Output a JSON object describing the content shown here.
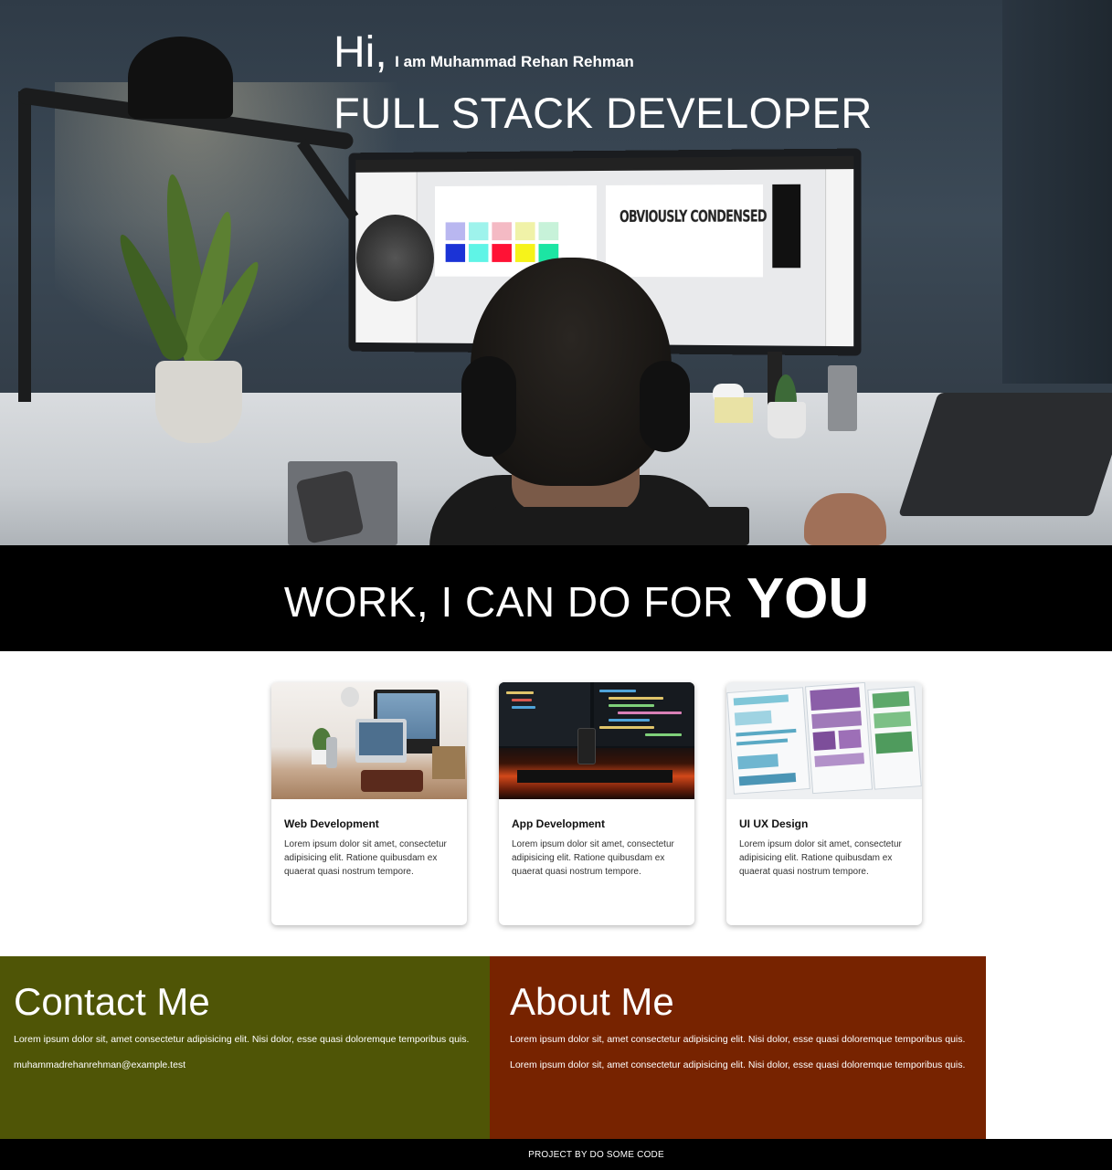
{
  "hero": {
    "greeting": "Hi,",
    "intro": "I am Muhammad Rehan Rehman",
    "role": "FULL STACK DEVELOPER",
    "screen_text": "OBVIOUSLY CONDENSED"
  },
  "work_banner": {
    "text": "WORK, I CAN DO FOR",
    "emphasis": "YOU"
  },
  "services": [
    {
      "title": "Web Development",
      "description": "Lorem ipsum dolor sit amet, consectetur adipisicing elit. Ratione quibusdam ex quaerat quasi nostrum tempore."
    },
    {
      "title": "App Development",
      "description": "Lorem ipsum dolor sit amet, consectetur adipisicing elit. Ratione quibusdam ex quaerat quasi nostrum tempore."
    },
    {
      "title": "UI UX Design",
      "description": "Lorem ipsum dolor sit amet, consectetur adipisicing elit. Ratione quibusdam ex quaerat quasi nostrum tempore."
    }
  ],
  "contact": {
    "title": "Contact Me",
    "text": "Lorem ipsum dolor sit, amet consectetur adipisicing elit. Nisi dolor, esse quasi doloremque temporibus quis.",
    "email": "muhammadrehanrehman@example.test",
    "background_color": "#4f5506"
  },
  "about": {
    "title": "About Me",
    "paragraphs": [
      "Lorem ipsum dolor sit, amet consectetur adipisicing elit. Nisi dolor, esse quasi doloremque temporibus quis.",
      "Lorem ipsum dolor sit, amet consectetur adipisicing elit. Nisi dolor, esse quasi doloremque temporibus quis."
    ],
    "background_color": "#772300"
  },
  "footer": {
    "text": "PROJECT BY DO SOME CODE"
  }
}
